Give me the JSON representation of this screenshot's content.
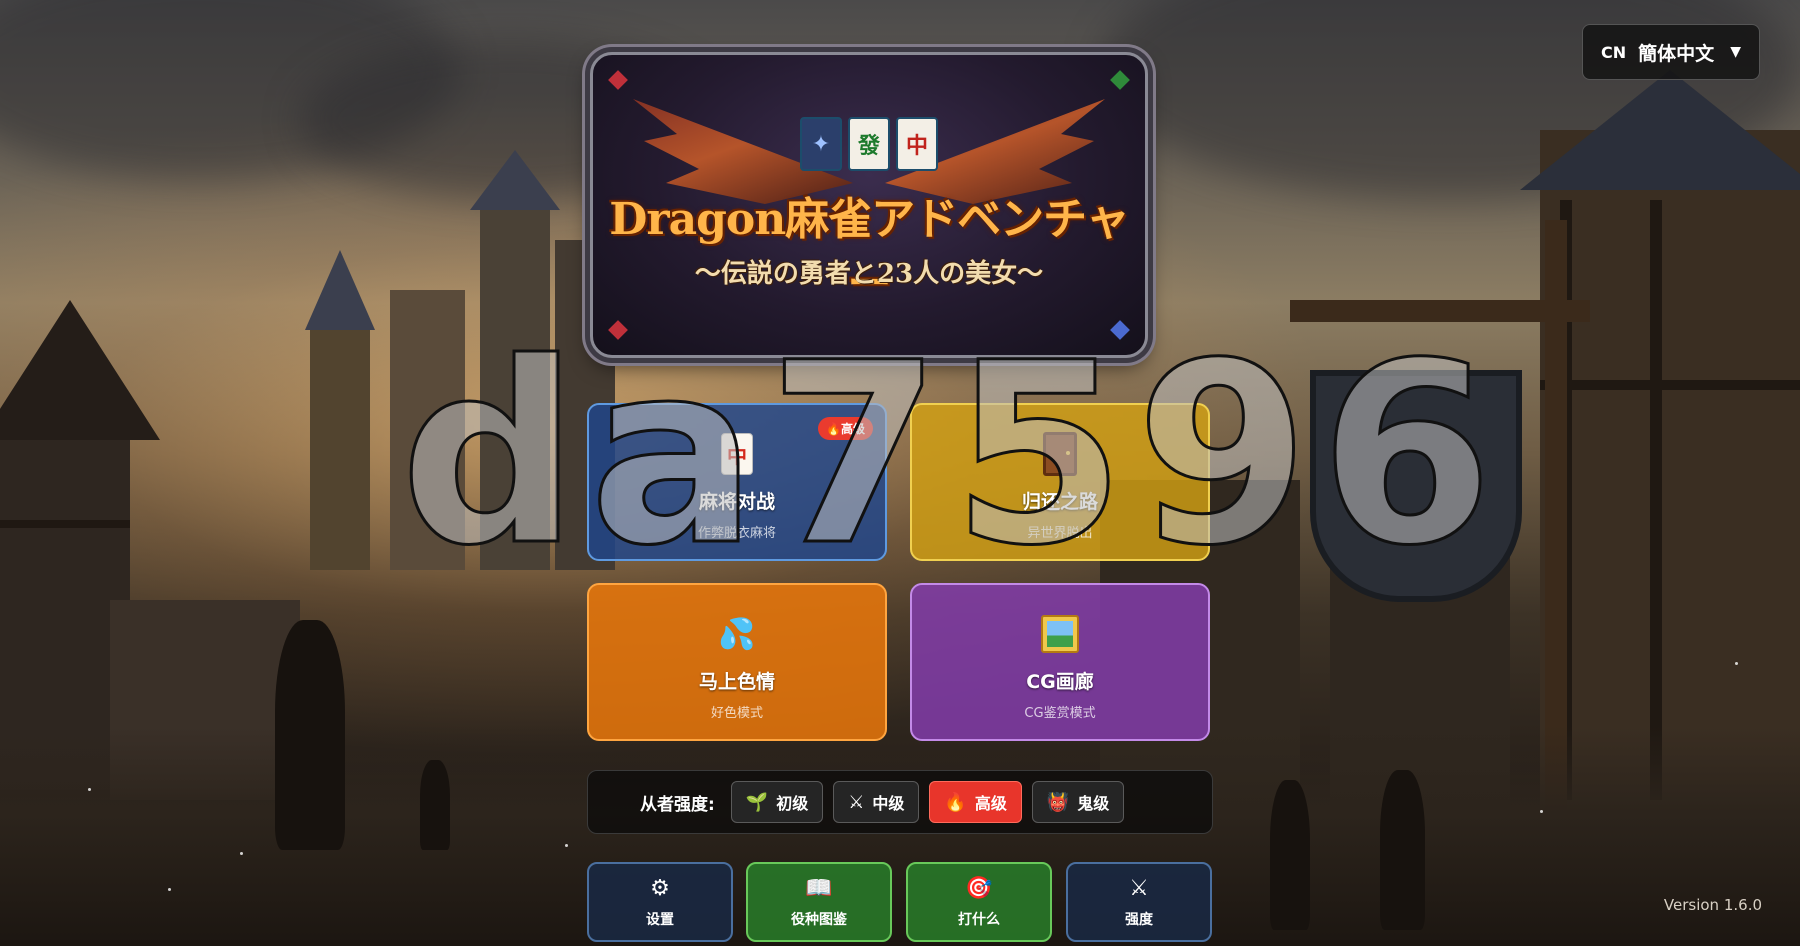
{
  "language": {
    "code": "CN",
    "label": "簡体中文",
    "arrow": "▼"
  },
  "logo": {
    "tiles": [
      "發",
      "中",
      "🀄",
      "🀇"
    ],
    "title": "Dragon麻雀アドベンチャー",
    "subtitle": "〜伝説の勇者と23人の美女〜"
  },
  "modes": [
    {
      "title": "麻将对战",
      "subtitle": "作弊脱衣麻将",
      "icon": "mahjong-tile-icon",
      "tile": "中",
      "badge": "🔥高级"
    },
    {
      "title": "归还之路",
      "subtitle": "异世界脱出",
      "icon": "door-icon"
    },
    {
      "title": "马上色情",
      "subtitle": "好色模式",
      "icon": "droplets-icon",
      "glyph": "💦"
    },
    {
      "title": "CG画廊",
      "subtitle": "CG鉴赏模式",
      "icon": "picture-frame-icon"
    }
  ],
  "strength": {
    "label": "从者强度:",
    "levels": [
      {
        "label": "初级",
        "icon": "🌱"
      },
      {
        "label": "中级",
        "icon": "⚔"
      },
      {
        "label": "高级",
        "icon": "🔥",
        "active": true
      },
      {
        "label": "鬼级",
        "icon": "👹"
      }
    ]
  },
  "bottom_buttons": [
    {
      "label": "设置",
      "icon": "⚙"
    },
    {
      "label": "役种图鉴",
      "icon": "📖"
    },
    {
      "label": "打什么",
      "icon": "🎯"
    },
    {
      "label": "强度",
      "icon": "⚔"
    }
  ],
  "version": "Version 1.6.0",
  "watermark": "da7596",
  "colors": {
    "active": "#e8352b",
    "blue": "#1e468c",
    "yellow": "#d2a014",
    "orange": "#eb780a",
    "purple": "#823caa"
  }
}
